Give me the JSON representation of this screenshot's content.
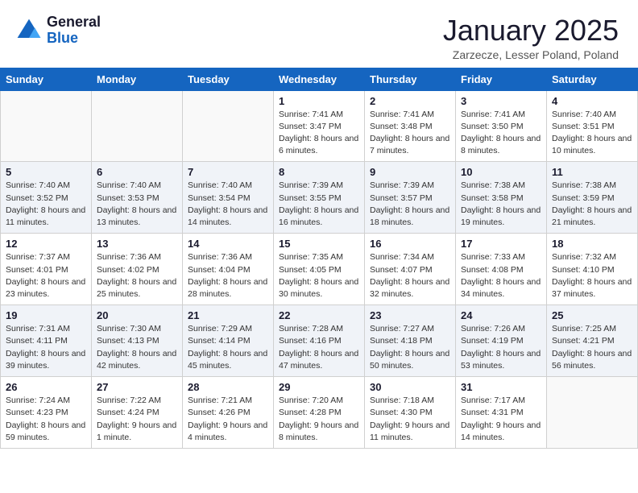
{
  "logo": {
    "general": "General",
    "blue": "Blue"
  },
  "title": "January 2025",
  "subtitle": "Zarzecze, Lesser Poland, Poland",
  "days_of_week": [
    "Sunday",
    "Monday",
    "Tuesday",
    "Wednesday",
    "Thursday",
    "Friday",
    "Saturday"
  ],
  "weeks": [
    [
      {
        "day": "",
        "info": ""
      },
      {
        "day": "",
        "info": ""
      },
      {
        "day": "",
        "info": ""
      },
      {
        "day": "1",
        "info": "Sunrise: 7:41 AM\nSunset: 3:47 PM\nDaylight: 8 hours and 6 minutes."
      },
      {
        "day": "2",
        "info": "Sunrise: 7:41 AM\nSunset: 3:48 PM\nDaylight: 8 hours and 7 minutes."
      },
      {
        "day": "3",
        "info": "Sunrise: 7:41 AM\nSunset: 3:50 PM\nDaylight: 8 hours and 8 minutes."
      },
      {
        "day": "4",
        "info": "Sunrise: 7:40 AM\nSunset: 3:51 PM\nDaylight: 8 hours and 10 minutes."
      }
    ],
    [
      {
        "day": "5",
        "info": "Sunrise: 7:40 AM\nSunset: 3:52 PM\nDaylight: 8 hours and 11 minutes."
      },
      {
        "day": "6",
        "info": "Sunrise: 7:40 AM\nSunset: 3:53 PM\nDaylight: 8 hours and 13 minutes."
      },
      {
        "day": "7",
        "info": "Sunrise: 7:40 AM\nSunset: 3:54 PM\nDaylight: 8 hours and 14 minutes."
      },
      {
        "day": "8",
        "info": "Sunrise: 7:39 AM\nSunset: 3:55 PM\nDaylight: 8 hours and 16 minutes."
      },
      {
        "day": "9",
        "info": "Sunrise: 7:39 AM\nSunset: 3:57 PM\nDaylight: 8 hours and 18 minutes."
      },
      {
        "day": "10",
        "info": "Sunrise: 7:38 AM\nSunset: 3:58 PM\nDaylight: 8 hours and 19 minutes."
      },
      {
        "day": "11",
        "info": "Sunrise: 7:38 AM\nSunset: 3:59 PM\nDaylight: 8 hours and 21 minutes."
      }
    ],
    [
      {
        "day": "12",
        "info": "Sunrise: 7:37 AM\nSunset: 4:01 PM\nDaylight: 8 hours and 23 minutes."
      },
      {
        "day": "13",
        "info": "Sunrise: 7:36 AM\nSunset: 4:02 PM\nDaylight: 8 hours and 25 minutes."
      },
      {
        "day": "14",
        "info": "Sunrise: 7:36 AM\nSunset: 4:04 PM\nDaylight: 8 hours and 28 minutes."
      },
      {
        "day": "15",
        "info": "Sunrise: 7:35 AM\nSunset: 4:05 PM\nDaylight: 8 hours and 30 minutes."
      },
      {
        "day": "16",
        "info": "Sunrise: 7:34 AM\nSunset: 4:07 PM\nDaylight: 8 hours and 32 minutes."
      },
      {
        "day": "17",
        "info": "Sunrise: 7:33 AM\nSunset: 4:08 PM\nDaylight: 8 hours and 34 minutes."
      },
      {
        "day": "18",
        "info": "Sunrise: 7:32 AM\nSunset: 4:10 PM\nDaylight: 8 hours and 37 minutes."
      }
    ],
    [
      {
        "day": "19",
        "info": "Sunrise: 7:31 AM\nSunset: 4:11 PM\nDaylight: 8 hours and 39 minutes."
      },
      {
        "day": "20",
        "info": "Sunrise: 7:30 AM\nSunset: 4:13 PM\nDaylight: 8 hours and 42 minutes."
      },
      {
        "day": "21",
        "info": "Sunrise: 7:29 AM\nSunset: 4:14 PM\nDaylight: 8 hours and 45 minutes."
      },
      {
        "day": "22",
        "info": "Sunrise: 7:28 AM\nSunset: 4:16 PM\nDaylight: 8 hours and 47 minutes."
      },
      {
        "day": "23",
        "info": "Sunrise: 7:27 AM\nSunset: 4:18 PM\nDaylight: 8 hours and 50 minutes."
      },
      {
        "day": "24",
        "info": "Sunrise: 7:26 AM\nSunset: 4:19 PM\nDaylight: 8 hours and 53 minutes."
      },
      {
        "day": "25",
        "info": "Sunrise: 7:25 AM\nSunset: 4:21 PM\nDaylight: 8 hours and 56 minutes."
      }
    ],
    [
      {
        "day": "26",
        "info": "Sunrise: 7:24 AM\nSunset: 4:23 PM\nDaylight: 8 hours and 59 minutes."
      },
      {
        "day": "27",
        "info": "Sunrise: 7:22 AM\nSunset: 4:24 PM\nDaylight: 9 hours and 1 minute."
      },
      {
        "day": "28",
        "info": "Sunrise: 7:21 AM\nSunset: 4:26 PM\nDaylight: 9 hours and 4 minutes."
      },
      {
        "day": "29",
        "info": "Sunrise: 7:20 AM\nSunset: 4:28 PM\nDaylight: 9 hours and 8 minutes."
      },
      {
        "day": "30",
        "info": "Sunrise: 7:18 AM\nSunset: 4:30 PM\nDaylight: 9 hours and 11 minutes."
      },
      {
        "day": "31",
        "info": "Sunrise: 7:17 AM\nSunset: 4:31 PM\nDaylight: 9 hours and 14 minutes."
      },
      {
        "day": "",
        "info": ""
      }
    ]
  ]
}
